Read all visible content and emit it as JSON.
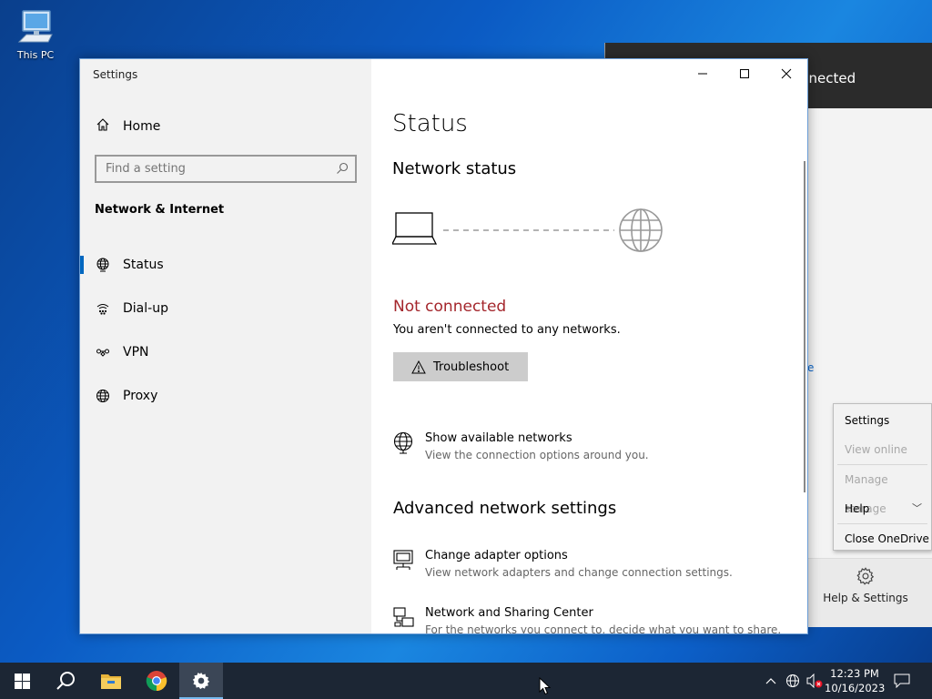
{
  "desktop": {
    "icon_label": "This PC"
  },
  "onedrive": {
    "header_text": "nnected",
    "link_fragment": "e",
    "help_settings_label": "Help & Settings"
  },
  "context_menu": {
    "items": [
      {
        "label": "Settings",
        "disabled": false
      },
      {
        "label": "View online",
        "disabled": true
      },
      {
        "label": "Manage storage",
        "disabled": true
      },
      {
        "label": "Help",
        "disabled": false
      },
      {
        "label": "Close OneDrive",
        "disabled": false
      }
    ]
  },
  "window": {
    "title": "Settings",
    "controls": {
      "minimize": "—",
      "maximize": "☐",
      "close": "✕"
    }
  },
  "sidebar": {
    "home_label": "Home",
    "search_placeholder": "Find a setting",
    "section_heading": "Network & Internet",
    "items": [
      {
        "label": "Status",
        "icon": "globe-status-icon",
        "active": true
      },
      {
        "label": "Dial-up",
        "icon": "dialup-icon",
        "active": false
      },
      {
        "label": "VPN",
        "icon": "vpn-icon",
        "active": false
      },
      {
        "label": "Proxy",
        "icon": "globe-icon",
        "active": false
      }
    ]
  },
  "main": {
    "page_title": "Status",
    "network_status_heading": "Network status",
    "connection_state": "Not connected",
    "connection_desc": "You aren't connected to any networks.",
    "troubleshoot_label": "Troubleshoot",
    "show_networks": {
      "title": "Show available networks",
      "desc": "View the connection options around you."
    },
    "advanced_heading": "Advanced network settings",
    "adapter_options": {
      "title": "Change adapter options",
      "desc": "View network adapters and change connection settings."
    },
    "sharing_center": {
      "title": "Network and Sharing Center",
      "desc": "For the networks you connect to, decide what you want to share."
    }
  },
  "taskbar": {
    "time": "12:23 PM",
    "date": "10/16/2023"
  },
  "colors": {
    "not_connected": "#a4262c",
    "accent": "#0067c0",
    "taskbar": "#1c2634"
  }
}
